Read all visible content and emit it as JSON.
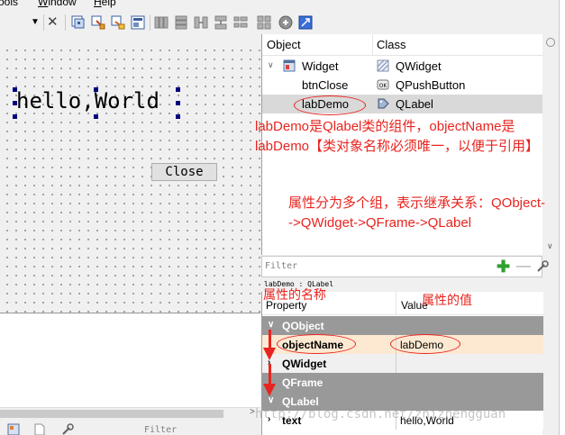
{
  "menubar": {
    "items": [
      "ools",
      "Window",
      "Help"
    ],
    "underlined": [
      "",
      "W",
      "H"
    ]
  },
  "toolbar": {
    "dropdown_icon": "chevron-down-icon",
    "buttons": [
      "close-x-icon",
      "edit-widgets-icon",
      "edit-signals-icon",
      "edit-buddies-icon",
      "edit-tab-order-icon",
      "layout-horizontal-icon",
      "layout-vertical-icon",
      "layout-splitter-h-icon",
      "layout-splitter-v-icon",
      "layout-form-icon",
      "layout-grid-icon",
      "break-layout-icon",
      "adjust-size-icon"
    ]
  },
  "form": {
    "label_text": "hello,World",
    "button_text": "Close"
  },
  "object_inspector": {
    "col_object": "Object",
    "col_class": "Class",
    "rows": [
      {
        "object": "Widget",
        "class": "QWidget",
        "icon": "widget-icon",
        "class_icon": "qwidget-class-icon"
      },
      {
        "object": "btnClose",
        "class": "QPushButton",
        "icon": "",
        "class_icon": "pushbutton-class-icon"
      },
      {
        "object": "labDemo",
        "class": "QLabel",
        "icon": "",
        "class_icon": "label-class-icon"
      }
    ],
    "filter_placeholder": "Filter",
    "info": "labDemo : QLabel"
  },
  "property_editor": {
    "col_property": "Property",
    "col_value": "Value",
    "rows": [
      {
        "name": "QObject",
        "value": "",
        "kind": "group",
        "expanded": true
      },
      {
        "name": "objectName",
        "value": "labDemo",
        "kind": "changed"
      },
      {
        "name": "QWidget",
        "value": "",
        "kind": "sub"
      },
      {
        "name": "QFrame",
        "value": "",
        "kind": "group"
      },
      {
        "name": "QLabel",
        "value": "",
        "kind": "group"
      },
      {
        "name": "text",
        "value": "hello,World",
        "kind": "sub"
      }
    ]
  },
  "bottom_left": {
    "filter_placeholder": "Filter"
  },
  "annotations": {
    "note1_line1": "labDemo是Qlabel类的组件，objectName是",
    "note1_line2": "labDemo【类对象名称必须唯一，以便于引用】",
    "note2_line1": "属性分为多个组，表示继承关系：QObject-",
    "note2_line2": "->QWidget->QFrame->QLabel",
    "prop_name_note": "属性的名称",
    "prop_value_note": "属性的值",
    "watermark": "http://blog.csdn.net/zhizhengguan"
  },
  "colors": {
    "annotation": "#e8241f",
    "group_row": "#999999",
    "changed_row": "#fde9d2",
    "selection_handle": "#000080"
  }
}
